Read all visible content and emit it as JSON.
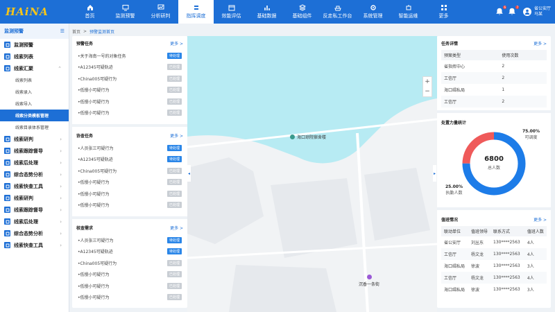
{
  "app": {
    "logo": "HAiNA"
  },
  "nav": [
    {
      "label": "首页",
      "icon": "home-icon"
    },
    {
      "label": "监测预警",
      "icon": "monitor-icon"
    },
    {
      "label": "分析研判",
      "icon": "chart-icon"
    },
    {
      "label": "指挥调度",
      "icon": "command-icon",
      "active": true
    },
    {
      "label": "效能评估",
      "icon": "calendar-icon"
    },
    {
      "label": "基础数据",
      "icon": "bars-icon"
    },
    {
      "label": "基础组件",
      "icon": "layers-icon"
    },
    {
      "label": "反走私工作台",
      "icon": "ship-icon"
    },
    {
      "label": "系统管理",
      "icon": "gear-icon"
    },
    {
      "label": "智能运维",
      "icon": "robot-icon"
    },
    {
      "label": "更多",
      "icon": "more-icon"
    }
  ],
  "topright": {
    "badge1": "6",
    "badge2": "7",
    "user_org": "省公安厅",
    "user_name": "马某"
  },
  "sidebar": {
    "title": "监测预警",
    "items": [
      {
        "label": "监测预警",
        "type": "item"
      },
      {
        "label": "线索列表",
        "type": "item"
      },
      {
        "label": "线索汇聚",
        "type": "item",
        "expanded": true
      },
      {
        "label": "线索列表",
        "type": "sub"
      },
      {
        "label": "线索录入",
        "type": "sub"
      },
      {
        "label": "线索导入",
        "type": "sub"
      },
      {
        "label": "线索分类模板管理",
        "type": "sub",
        "active": true
      },
      {
        "label": "线索目录体系管理",
        "type": "sub"
      },
      {
        "label": "线索研判",
        "type": "item",
        "chevron": true
      },
      {
        "label": "线索跟踪督导",
        "type": "item",
        "chevron": true
      },
      {
        "label": "线索后处理",
        "type": "item",
        "chevron": true
      },
      {
        "label": "综合态势分析",
        "type": "item",
        "chevron": true
      },
      {
        "label": "线索快查工具",
        "type": "item",
        "chevron": true
      },
      {
        "label": "线索研判",
        "type": "item",
        "chevron": true
      },
      {
        "label": "线索跟踪督导",
        "type": "item",
        "chevron": true
      },
      {
        "label": "线索后处理",
        "type": "item",
        "chevron": true
      },
      {
        "label": "综合态势分析",
        "type": "item",
        "chevron": true
      },
      {
        "label": "线索快查工具",
        "type": "item",
        "chevron": true
      }
    ]
  },
  "breadcrumb": {
    "home": "首页",
    "sep": ">",
    "current": "预警监测首页"
  },
  "left_panel": {
    "more": "更多 >",
    "sections": [
      {
        "title": "预警任务",
        "rows": [
          {
            "text": "•关于海南一号的对象任务",
            "status": "待处理",
            "color": "blue"
          },
          {
            "text": "•A12345可疑轨迹",
            "status": "已处理",
            "color": "gray"
          },
          {
            "text": "•China005可疑行为",
            "status": "已处理",
            "color": "gray"
          },
          {
            "text": "•低慢小可疑行为",
            "status": "已处理",
            "color": "gray"
          },
          {
            "text": "•低慢小可疑行为",
            "status": "已处理",
            "color": "gray"
          },
          {
            "text": "•低慢小可疑行为",
            "status": "已处理",
            "color": "gray"
          }
        ]
      },
      {
        "title": "协查任务",
        "rows": [
          {
            "text": "•人员张三可疑行为",
            "status": "待处理",
            "color": "blue"
          },
          {
            "text": "•A12345可疑轨迹",
            "status": "待处理",
            "color": "blue"
          },
          {
            "text": "•China005可疑行为",
            "status": "已处理",
            "color": "gray"
          },
          {
            "text": "•低慢小可疑行为",
            "status": "已处理",
            "color": "gray"
          },
          {
            "text": "•低慢小可疑行为",
            "status": "已处理",
            "color": "gray"
          },
          {
            "text": "•低慢小可疑行为",
            "status": "已处理",
            "color": "gray"
          }
        ]
      },
      {
        "title": "核查需求",
        "rows": [
          {
            "text": "•人员张三可疑行为",
            "status": "待处理",
            "color": "blue"
          },
          {
            "text": "•A12345可疑轨迹",
            "status": "待处理",
            "color": "blue"
          },
          {
            "text": "•China005可疑行为",
            "status": "已处理",
            "color": "gray"
          },
          {
            "text": "•低慢小可疑行为",
            "status": "已处理",
            "color": "gray"
          },
          {
            "text": "•低慢小可疑行为",
            "status": "已处理",
            "color": "gray"
          },
          {
            "text": "•低慢小可疑行为",
            "status": "已处理",
            "color": "gray"
          }
        ]
      }
    ]
  },
  "map": {
    "marker1": "海口琼院宿舍楼",
    "marker2": "沉香一条街",
    "zoom_in": "+",
    "zoom_out": "−"
  },
  "right_panel": {
    "task_title": "任务详情",
    "more": "更多 >",
    "task_headers": [
      "预案类型",
      "使用次数"
    ],
    "task_rows": [
      [
        "省指挥中心",
        "2"
      ],
      [
        "工信厅",
        "2"
      ],
      [
        "海口缉私局",
        "1"
      ],
      [
        "工信厅",
        "2"
      ]
    ],
    "force_title": "处置力量统计",
    "donut": {
      "total": "6800",
      "total_label": "总人数",
      "pct_a": "75.00%",
      "label_a": "可调度",
      "pct_b": "25.00%",
      "label_b": "执勤人数",
      "value_a": 75,
      "value_b": 25,
      "color_a": "#1d7ce8",
      "color_b": "#ef5a5a"
    },
    "duty_title": "值班情况",
    "duty_headers": [
      "联动单位",
      "值班领导",
      "联系方式",
      "值班人数"
    ],
    "duty_rows": [
      [
        "省公安厅",
        "刘丛东",
        "130****2563",
        "4人"
      ],
      [
        "工信厅",
        "杨文龙",
        "130****2563",
        "4人"
      ],
      [
        "海口缉私局",
        "徐波",
        "130****2563",
        "3人"
      ],
      [
        "工信厅",
        "杨文龙",
        "130****2563",
        "4人"
      ],
      [
        "海口缉私局",
        "徐波",
        "130****2563",
        "3人"
      ]
    ]
  }
}
